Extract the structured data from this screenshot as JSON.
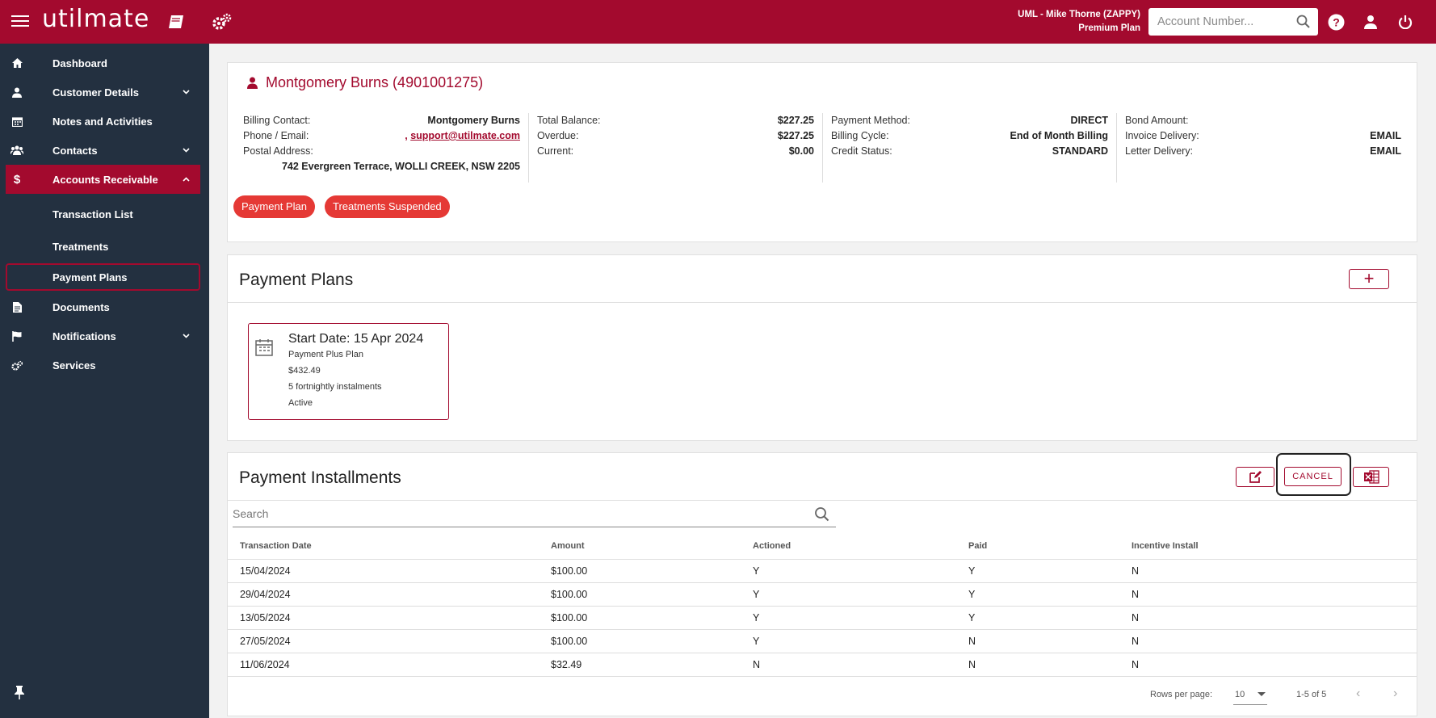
{
  "app": {
    "logo": "utilmate"
  },
  "header": {
    "user_line1": "UML - Mike Thorne (ZAPPY)",
    "user_line2": "Premium Plan",
    "account_search_placeholder": "Account Number..."
  },
  "sidebar": {
    "items": [
      {
        "label": "Dashboard",
        "icon": "home-icon"
      },
      {
        "label": "Customer Details",
        "icon": "person-icon",
        "expand": "chevron-down"
      },
      {
        "label": "Notes and Activities",
        "icon": "calendar-icon"
      },
      {
        "label": "Contacts",
        "icon": "group-icon",
        "expand": "chevron-down"
      },
      {
        "label": "Accounts Receivable",
        "icon": "dollar-icon",
        "expand": "chevron-up"
      },
      {
        "label": "Documents",
        "icon": "document-icon"
      },
      {
        "label": "Notifications",
        "icon": "flag-icon",
        "expand": "chevron-down"
      },
      {
        "label": "Services",
        "icon": "cogs-icon"
      }
    ],
    "sub_items": [
      {
        "label": "Transaction List"
      },
      {
        "label": "Treatments"
      },
      {
        "label": "Payment Plans"
      }
    ]
  },
  "customer": {
    "title": "Montgomery Burns (4901001275)",
    "col1": {
      "billing_contact_label": "Billing Contact:",
      "billing_contact": "Montgomery Burns",
      "phone_email_label": "Phone / Email:",
      "phone_prefix": ",",
      "email": "support@utilmate.com",
      "postal_label": "Postal Address:",
      "postal": "742 Evergreen Terrace, WOLLI CREEK, NSW 2205"
    },
    "col2": {
      "total_balance_label": "Total Balance:",
      "total_balance": "$227.25",
      "overdue_label": "Overdue:",
      "overdue": "$227.25",
      "current_label": "Current:",
      "current": "$0.00"
    },
    "col3": {
      "payment_method_label": "Payment Method:",
      "payment_method": "DIRECT",
      "billing_cycle_label": "Billing Cycle:",
      "billing_cycle": "End of Month Billing",
      "credit_status_label": "Credit Status:",
      "credit_status": "STANDARD"
    },
    "col4": {
      "bond_label": "Bond Amount:",
      "bond": "",
      "invoice_label": "Invoice Delivery:",
      "invoice": "EMAIL",
      "letter_label": "Letter Delivery:",
      "letter": "EMAIL"
    },
    "badges": [
      "Payment Plan",
      "Treatments Suspended"
    ],
    "badge_color": "#e53935"
  },
  "plans": {
    "title": "Payment Plans",
    "add_label": "+",
    "tile": {
      "start_date": "Start Date: 15 Apr 2024",
      "plan_name": "Payment Plus Plan",
      "amount": "$432.49",
      "installments": "5 fortnightly instalments",
      "status": "Active"
    }
  },
  "installments": {
    "title": "Payment Installments",
    "cancel_label": "CANCEL",
    "search_placeholder": "Search",
    "columns": [
      "Transaction Date",
      "Amount",
      "Actioned",
      "Paid",
      "Incentive Install"
    ],
    "rows": [
      [
        "15/04/2024",
        "$100.00",
        "Y",
        "Y",
        "N"
      ],
      [
        "29/04/2024",
        "$100.00",
        "Y",
        "Y",
        "N"
      ],
      [
        "13/05/2024",
        "$100.00",
        "Y",
        "Y",
        "N"
      ],
      [
        "27/05/2024",
        "$100.00",
        "Y",
        "N",
        "N"
      ],
      [
        "11/06/2024",
        "$32.49",
        "N",
        "N",
        "N"
      ]
    ],
    "footer": {
      "rows_per_page_label": "Rows per page:",
      "rows_per_page": "10",
      "range": "1-5 of 5"
    }
  },
  "colors": {
    "brand": "#a30a2e",
    "sidebar": "#233040"
  }
}
